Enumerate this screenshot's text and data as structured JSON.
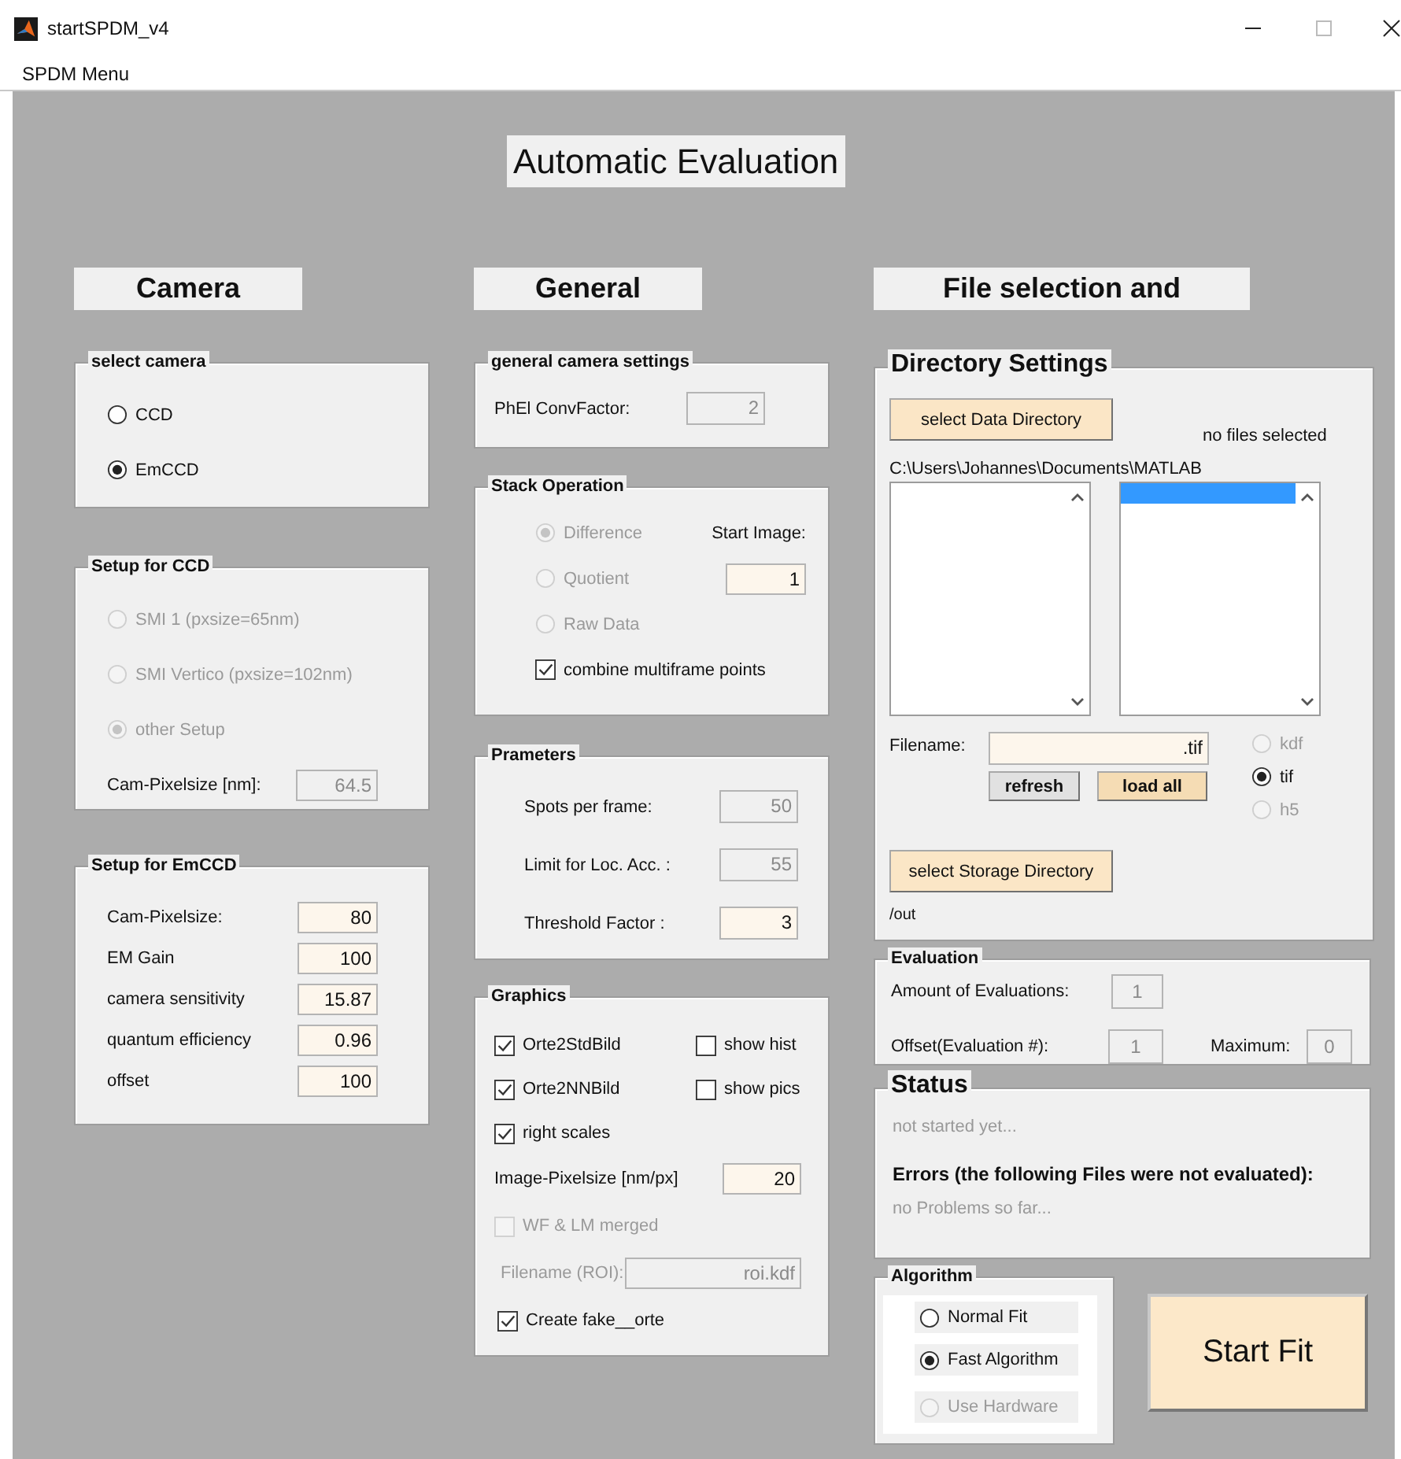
{
  "window": {
    "title": "startSPDM_v4"
  },
  "menu": [
    "SPDM Menu"
  ],
  "heading": "Automatic Evaluation",
  "camera": {
    "title": "Camera",
    "select_camera": {
      "title": "select camera",
      "options": [
        {
          "label": "CCD",
          "selected": false
        },
        {
          "label": "EmCCD",
          "selected": true
        }
      ]
    },
    "setup_ccd": {
      "title": "Setup for CCD",
      "options": [
        {
          "label": "SMI 1 (pxsize=65nm)",
          "selected": false,
          "disabled": true
        },
        {
          "label": "SMI Vertico (pxsize=102nm)",
          "selected": false,
          "disabled": true
        },
        {
          "label": "other Setup",
          "selected": true,
          "disabled": true
        }
      ],
      "pixelsize": {
        "label": "Cam-Pixelsize [nm]:",
        "value": "64.5",
        "disabled": true
      }
    },
    "setup_emccd": {
      "title": "Setup for EmCCD",
      "fields": [
        {
          "label": "Cam-Pixelsize:",
          "value": "80"
        },
        {
          "label": "EM Gain",
          "value": "100"
        },
        {
          "label": "camera sensitivity",
          "value": "15.87"
        },
        {
          "label": "quantum efficiency",
          "value": "0.96"
        },
        {
          "label": "offset",
          "value": "100"
        }
      ]
    }
  },
  "general": {
    "title": "General",
    "camera_settings": {
      "title": "general camera settings",
      "field": {
        "label": "PhEl ConvFactor:",
        "value": "2",
        "disabled": true
      }
    },
    "stack_operation": {
      "title": "Stack Operation",
      "options": [
        {
          "label": "Difference",
          "selected": true,
          "disabled": true
        },
        {
          "label": "Quotient",
          "selected": false,
          "disabled": true
        },
        {
          "label": "Raw Data",
          "selected": false,
          "disabled": true
        }
      ],
      "start_image": {
        "label": "Start Image:",
        "value": "1"
      },
      "combine": {
        "label": "combine multiframe points",
        "checked": true
      }
    },
    "parameters": {
      "title": "Prameters",
      "fields": [
        {
          "label": "Spots per frame:",
          "value": "50",
          "disabled": true
        },
        {
          "label": "Limit for Loc. Acc. :",
          "value": "55",
          "disabled": true
        },
        {
          "label": "Threshold Factor :",
          "value": "3",
          "disabled": false
        }
      ]
    },
    "graphics": {
      "title": "Graphics",
      "checkboxes": [
        {
          "label": "Orte2StdBild",
          "checked": true
        },
        {
          "label": "show hist",
          "checked": false
        },
        {
          "label": "Orte2NNBild",
          "checked": true
        },
        {
          "label": "show pics",
          "checked": false
        },
        {
          "label": "right scales",
          "checked": true
        }
      ],
      "pixelsize": {
        "label": "Image-Pixelsize [nm/px]",
        "value": "20"
      },
      "merged": {
        "label": "WF & LM merged",
        "checked": false,
        "disabled": true
      },
      "roi": {
        "label": "Filename (ROI):",
        "value": "roi.kdf",
        "disabled": true
      },
      "fake": {
        "label": "Create fake__orte",
        "checked": true
      }
    }
  },
  "files": {
    "title": "File selection and",
    "directory": {
      "title": "Directory Settings",
      "data_button": "select Data Directory",
      "files_status": "no files selected",
      "path": "C:\\Users\\Johannes\\Documents\\MATLAB",
      "lists": [
        {
          "selected_row": false
        },
        {
          "selected_row": true
        }
      ],
      "filename": {
        "label": "Filename:",
        "value": ".tif"
      },
      "buttons": [
        {
          "label": "refresh",
          "kind": "plain"
        },
        {
          "label": "load all",
          "kind": "accent"
        }
      ],
      "formats": [
        {
          "label": "kdf",
          "selected": false,
          "disabled": true
        },
        {
          "label": "tif",
          "selected": true,
          "disabled": false
        },
        {
          "label": "h5",
          "selected": false,
          "disabled": true
        }
      ],
      "storage_button": "select Storage Directory",
      "storage_path": "/out"
    },
    "evaluation": {
      "title": "Evaluation",
      "amount": {
        "label": "Amount of Evaluations:",
        "value": "1",
        "disabled": true
      },
      "offset": {
        "label": "Offset(Evaluation #):",
        "value": "1",
        "disabled": true
      },
      "maximum": {
        "label": "Maximum:",
        "value": "0",
        "disabled": true
      }
    },
    "status": {
      "title": "Status",
      "message": "not started yet...",
      "errors_title": "Errors (the following Files were not evaluated):",
      "errors": "no Problems so far..."
    },
    "algorithm": {
      "title": "Algorithm",
      "options": [
        {
          "label": "Normal Fit",
          "selected": false,
          "disabled": false
        },
        {
          "label": "Fast Algorithm",
          "selected": true,
          "disabled": false
        },
        {
          "label": "Use Hardware",
          "selected": false,
          "disabled": true
        }
      ]
    },
    "start_button": "Start Fit"
  }
}
